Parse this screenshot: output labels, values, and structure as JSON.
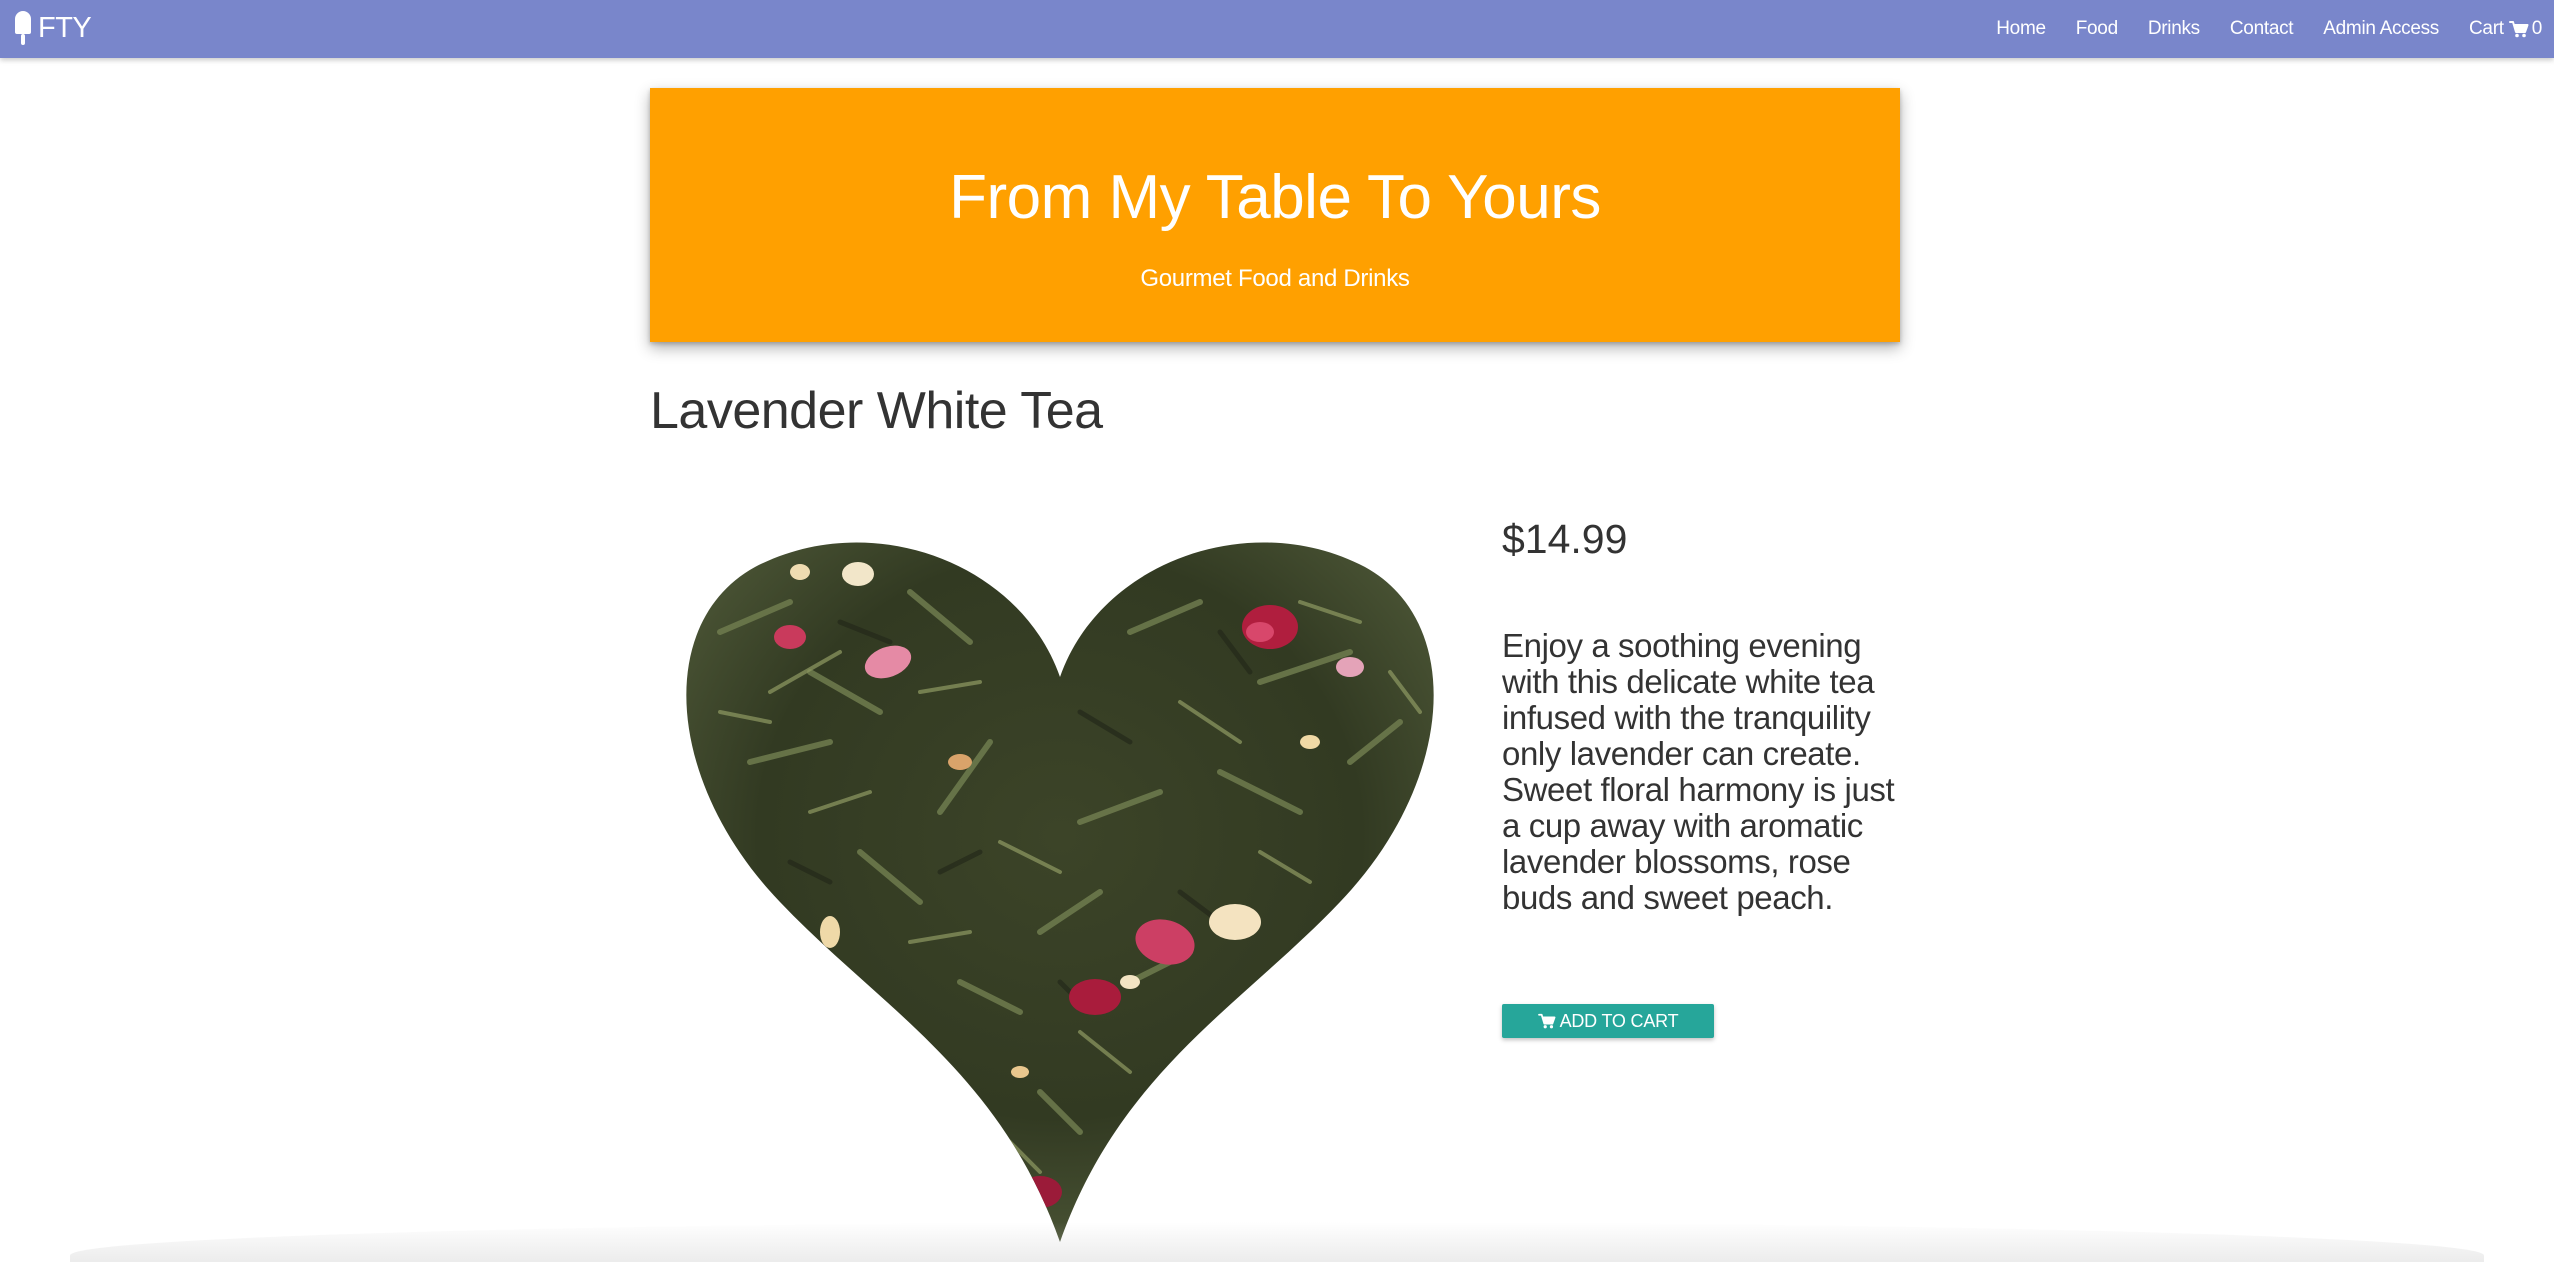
{
  "navbar": {
    "brand_text": "FTY",
    "brand_icon": "popsicle-icon",
    "links": [
      {
        "label": "Home"
      },
      {
        "label": "Food"
      },
      {
        "label": "Drinks"
      },
      {
        "label": "Contact"
      },
      {
        "label": "Admin Access"
      }
    ],
    "cart": {
      "label": "Cart",
      "icon": "cart-icon",
      "count": "0"
    },
    "background_color": "#7986cb"
  },
  "hero": {
    "title": "From My Table To Yours",
    "subtitle": "Gourmet Food and Drinks",
    "background_color": "#ffa000"
  },
  "product": {
    "name": "Lavender White Tea",
    "price": "$14.99",
    "description": "Enjoy a soothing evening with this delicate white tea infused with the tranquility only lavender can create. Sweet floral harmony is just a cup away with aromatic lavender blossoms, rose buds and sweet peach.",
    "image": "heart-shaped-loose-leaf-tea-image",
    "add_to_cart": {
      "label": "ADD TO CART",
      "icon": "cart-icon",
      "color": "#26a69a"
    }
  }
}
